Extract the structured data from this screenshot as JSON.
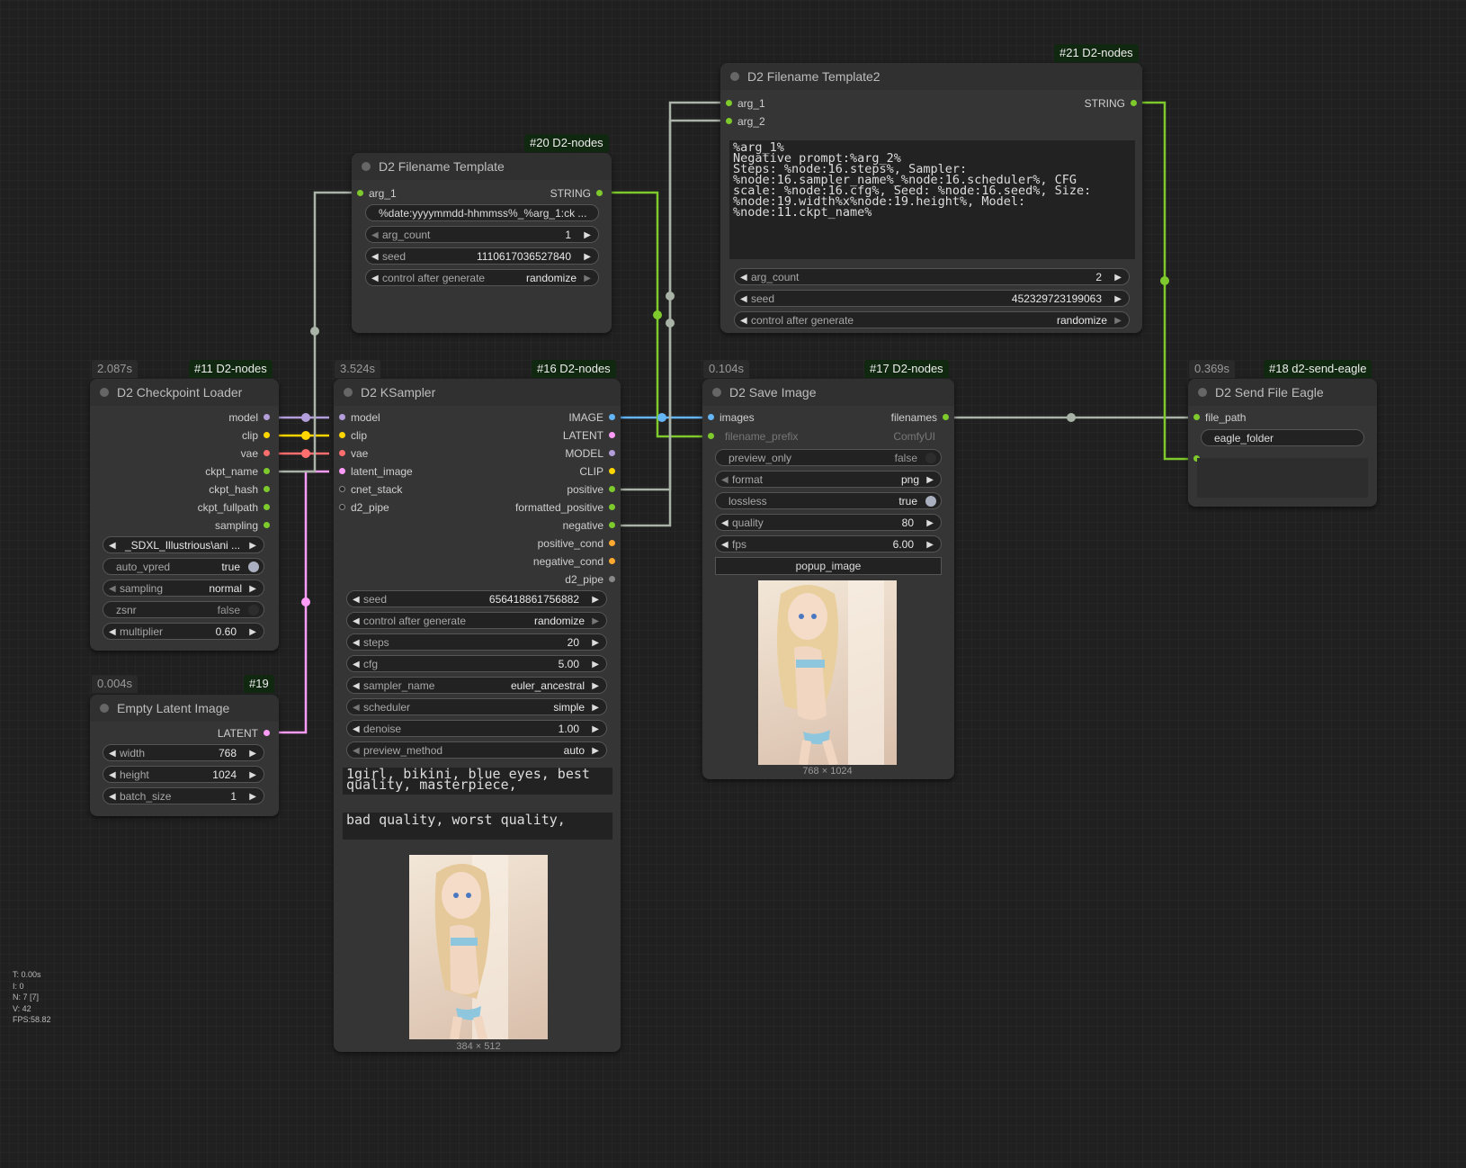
{
  "colors": {
    "background": "#202020",
    "model": "#b39ddb",
    "clip": "#ffd500",
    "vae": "#ff6e6e",
    "latent": "#ff9cf9",
    "image": "#64b5f6",
    "string": "#7eca2d",
    "conditioning": "#ffa931",
    "gray": "#aab3a8",
    "pipe": "#888888"
  },
  "nodes": {
    "n21": {
      "badge": "#21 D2-nodes",
      "title": "D2 Filename Template2",
      "inputs": [
        "arg_1",
        "arg_2"
      ],
      "output": "STRING",
      "text": "%arg_1%\nNegative prompt:%arg_2%\nSteps: %node:16.steps%, Sampler:\n%node:16.sampler_name%_%node:16.scheduler%, CFG\nscale: %node:16.cfg%, Seed: %node:16.seed%, Size:\n%node:19.width%x%node:19.height%, Model:\n%node:11.ckpt_name%",
      "widgets": [
        {
          "label": "arg_count",
          "value": "2"
        },
        {
          "label": "seed",
          "value": "452329723199063"
        },
        {
          "label": "control after generate",
          "value": "randomize"
        }
      ]
    },
    "n20": {
      "badge": "#20 D2-nodes",
      "title": "D2 Filename Template",
      "input": "arg_1",
      "output": "STRING",
      "template": "%date:yyyymmdd-hhmmss%_%arg_1:ck ...",
      "widgets": [
        {
          "label": "arg_count",
          "value": "1"
        },
        {
          "label": "seed",
          "value": "1110617036527840"
        },
        {
          "label": "control after generate",
          "value": "randomize"
        }
      ]
    },
    "n11": {
      "timer": "2.087s",
      "badge": "#11 D2-nodes",
      "title": "D2 Checkpoint Loader",
      "outputs": [
        "model",
        "clip",
        "vae",
        "ckpt_name",
        "ckpt_hash",
        "ckpt_fullpath",
        "sampling"
      ],
      "ckpt": "_SDXL_Illustrious\\ani ...",
      "widgets": [
        {
          "label": "auto_vpred",
          "value": "true"
        },
        {
          "label": "sampling",
          "value": "normal"
        },
        {
          "label": "zsnr",
          "value": "false"
        },
        {
          "label": "multiplier",
          "value": "0.60"
        }
      ]
    },
    "n19": {
      "timer": "0.004s",
      "badge": "#19",
      "title": "Empty Latent Image",
      "output": "LATENT",
      "widgets": [
        {
          "label": "width",
          "value": "768"
        },
        {
          "label": "height",
          "value": "1024"
        },
        {
          "label": "batch_size",
          "value": "1"
        }
      ]
    },
    "n16": {
      "timer": "3.524s",
      "badge": "#16 D2-nodes",
      "title": "D2 KSampler",
      "inputs": [
        "model",
        "clip",
        "vae",
        "latent_image",
        "cnet_stack",
        "d2_pipe"
      ],
      "outputs": [
        "IMAGE",
        "LATENT",
        "MODEL",
        "CLIP",
        "positive",
        "formatted_positive",
        "negative",
        "positive_cond",
        "negative_cond",
        "d2_pipe"
      ],
      "widgets": [
        {
          "label": "seed",
          "value": "656418861756882"
        },
        {
          "label": "control after generate",
          "value": "randomize"
        },
        {
          "label": "steps",
          "value": "20"
        },
        {
          "label": "cfg",
          "value": "5.00"
        },
        {
          "label": "sampler_name",
          "value": "euler_ancestral"
        },
        {
          "label": "scheduler",
          "value": "simple"
        },
        {
          "label": "denoise",
          "value": "1.00"
        },
        {
          "label": "preview_method",
          "value": "auto"
        }
      ],
      "positive_text": "1girl, bikini, blue eyes, best\nquality, masterpiece,",
      "negative_text": "bad quality, worst quality,",
      "preview_caption": "384 × 512"
    },
    "n17": {
      "timer": "0.104s",
      "badge": "#17 D2-nodes",
      "title": "D2 Save Image",
      "input": "images",
      "output": "filenames",
      "filename_prefix_label": "filename_prefix",
      "filename_prefix_value": "ComfyUI",
      "widgets": [
        {
          "label": "preview_only",
          "value": "false"
        },
        {
          "label": "format",
          "value": "png"
        },
        {
          "label": "lossless",
          "value": "true"
        },
        {
          "label": "quality",
          "value": "80"
        },
        {
          "label": "fps",
          "value": "6.00"
        }
      ],
      "button": "popup_image",
      "preview_caption": "768 × 1024"
    },
    "n18": {
      "timer": "0.369s",
      "badge": "#18 d2-send-eagle",
      "title": "D2 Send File Eagle",
      "input": "file_path",
      "eagle_folder": "eagle_folder"
    }
  },
  "stats": {
    "t": "T: 0.00s",
    "i": "I: 0",
    "n": "N: 7 [7]",
    "v": "V: 42",
    "fps": "FPS:58.82"
  }
}
